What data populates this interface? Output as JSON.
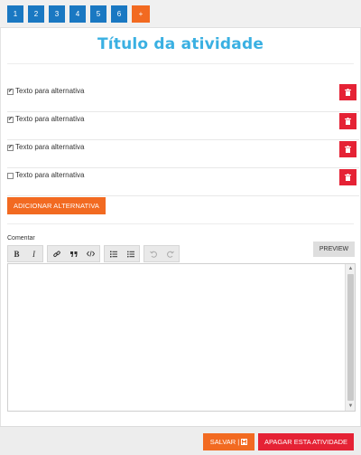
{
  "pager": {
    "pages": [
      "1",
      "2",
      "3",
      "4",
      "5",
      "6"
    ],
    "add_label": "+"
  },
  "activity": {
    "title": "Título da atividade"
  },
  "alternatives": [
    {
      "text": "Texto para alternativa",
      "checked": true
    },
    {
      "text": "Texto para alternativa",
      "checked": true
    },
    {
      "text": "Texto para alternativa",
      "checked": true
    },
    {
      "text": "Texto para alternativa",
      "checked": false
    }
  ],
  "buttons": {
    "add_alternative": "ADICIONAR ALTERNATIVA",
    "preview": "PREVIEW",
    "save": "SALVAR |",
    "delete_activity": "APAGAR ESTA ATIVIDADE"
  },
  "comment": {
    "label": "Comentar",
    "value": ""
  },
  "toolbar": {
    "bold": "B",
    "italic": "I"
  },
  "colors": {
    "primary_blue": "#1a78c2",
    "accent_orange": "#f26a21",
    "danger_red": "#e52235",
    "title_blue": "#3ab0e2"
  },
  "icons": [
    "link-icon",
    "quote-icon",
    "code-icon",
    "ordered-list-icon",
    "bullet-list-icon",
    "undo-icon",
    "redo-icon",
    "trash-icon",
    "save-icon",
    "checkmark-icon"
  ]
}
